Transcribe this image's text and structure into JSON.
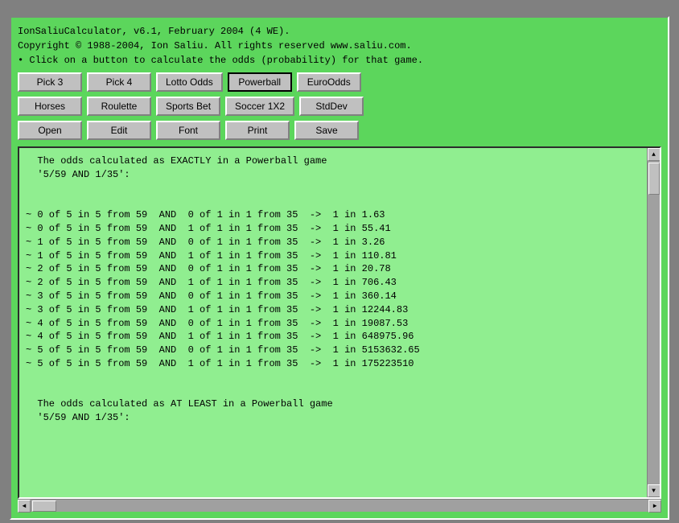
{
  "titleBar": {
    "line1": "IonSaliuCalculator, v6.1, February 2004 (4 WE).",
    "line2": "Copyright © 1988-2004, Ion Saliu. All rights reserved www.saliu.com.",
    "line3": "• Click on a button to calculate the odds (probability) for that game."
  },
  "row1Buttons": [
    {
      "label": "Pick 3",
      "name": "pick3-button",
      "active": false
    },
    {
      "label": "Pick 4",
      "name": "pick4-button",
      "active": false
    },
    {
      "label": "Lotto Odds",
      "name": "lotto-odds-button",
      "active": false
    },
    {
      "label": "Powerball",
      "name": "powerball-button",
      "active": true
    },
    {
      "label": "EuroOdds",
      "name": "euroodds-button",
      "active": false
    }
  ],
  "row2Buttons": [
    {
      "label": "Horses",
      "name": "horses-button",
      "active": false
    },
    {
      "label": "Roulette",
      "name": "roulette-button",
      "active": false
    },
    {
      "label": "Sports Bet",
      "name": "sports-bet-button",
      "active": false
    },
    {
      "label": "Soccer 1X2",
      "name": "soccer-button",
      "active": false
    },
    {
      "label": "StdDev",
      "name": "stddev-button",
      "active": false
    }
  ],
  "row3Buttons": [
    {
      "label": "Open",
      "name": "open-button",
      "active": false
    },
    {
      "label": "Edit",
      "name": "edit-button",
      "active": false
    },
    {
      "label": "Font",
      "name": "font-button",
      "active": false
    },
    {
      "label": "Print",
      "name": "print-button",
      "active": false
    },
    {
      "label": "Save",
      "name": "save-button",
      "active": false
    }
  ],
  "outputText": "  The odds calculated as EXACTLY in a Powerball game\n  '5/59 AND 1/35':\n\n\n~ 0 of 5 in 5 from 59  AND  0 of 1 in 1 from 35  ->  1 in 1.63\n~ 0 of 5 in 5 from 59  AND  1 of 1 in 1 from 35  ->  1 in 55.41\n~ 1 of 5 in 5 from 59  AND  0 of 1 in 1 from 35  ->  1 in 3.26\n~ 1 of 5 in 5 from 59  AND  1 of 1 in 1 from 35  ->  1 in 110.81\n~ 2 of 5 in 5 from 59  AND  0 of 1 in 1 from 35  ->  1 in 20.78\n~ 2 of 5 in 5 from 59  AND  1 of 1 in 1 from 35  ->  1 in 706.43\n~ 3 of 5 in 5 from 59  AND  0 of 1 in 1 from 35  ->  1 in 360.14\n~ 3 of 5 in 5 from 59  AND  1 of 1 in 1 from 35  ->  1 in 12244.83\n~ 4 of 5 in 5 from 59  AND  0 of 1 in 1 from 35  ->  1 in 19087.53\n~ 4 of 5 in 5 from 59  AND  1 of 1 in 1 from 35  ->  1 in 648975.96\n~ 5 of 5 in 5 from 59  AND  0 of 1 in 1 from 35  ->  1 in 5153632.65\n~ 5 of 5 in 5 from 59  AND  1 of 1 in 1 from 35  ->  1 in 175223510\n\n\n  The odds calculated as AT LEAST in a Powerball game\n  '5/59 AND 1/35':\n"
}
